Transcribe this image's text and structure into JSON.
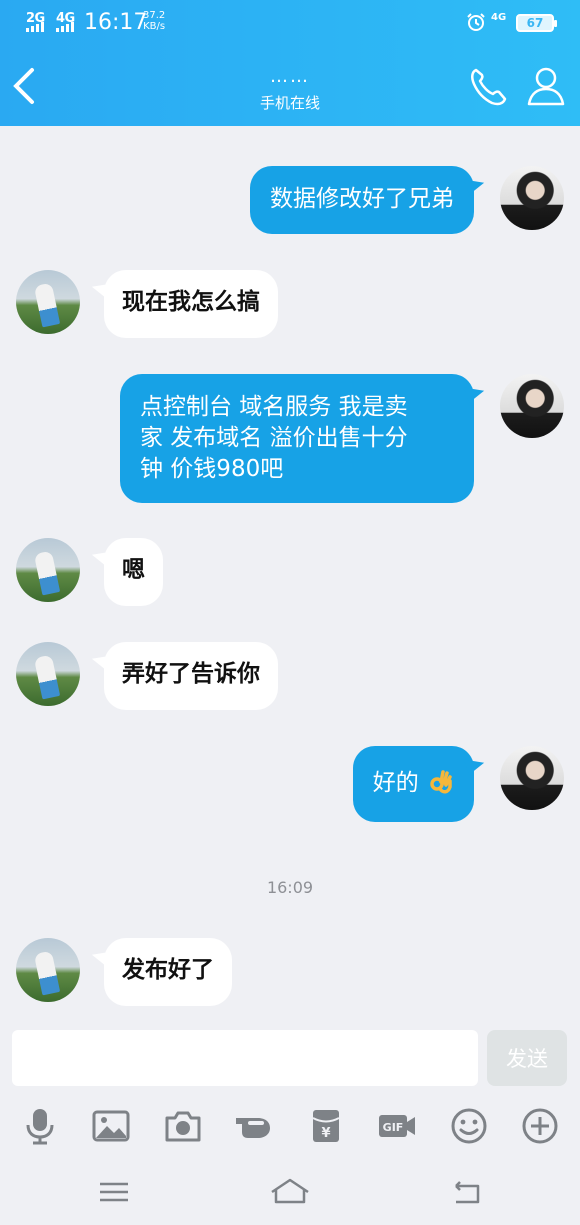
{
  "status_bar": {
    "sim1": "2G",
    "sim2": "4G",
    "time": "16:17",
    "speed_value": "37.2",
    "speed_unit": "KB/s",
    "network": "4G",
    "battery": "67"
  },
  "header": {
    "nickname": "……",
    "status": "手机在线",
    "back_icon": "chevron-left-icon",
    "call_icon": "phone-icon",
    "profile_icon": "person-icon",
    "color": "#2aa9f2"
  },
  "messages": [
    {
      "side": "me",
      "text": "数据修改好了兄弟"
    },
    {
      "side": "other",
      "text": "现在我怎么搞"
    },
    {
      "side": "me",
      "lines": [
        "点控制台  域名服务 我是卖",
        "家 发布域名  溢价出售十分",
        "钟  价钱980吧"
      ]
    },
    {
      "side": "other",
      "text": "嗯"
    },
    {
      "side": "other",
      "text": "弄好了告诉你"
    },
    {
      "side": "me",
      "text": "好的",
      "emoji": "ok-hand-icon"
    },
    {
      "side": "other",
      "text": "发布好了"
    }
  ],
  "timestamp": "16:09",
  "input": {
    "placeholder": "",
    "value": "",
    "send_label": "发送"
  },
  "toolbar": [
    "microphone-icon",
    "image-icon",
    "camera-icon",
    "poke-hand-icon",
    "red-packet-icon",
    "gif-icon",
    "smiley-icon",
    "plus-icon"
  ],
  "nav": [
    "menu-icon",
    "home-icon",
    "back-icon"
  ],
  "colors": {
    "bubble_me": "#17a2e6",
    "bubble_other": "#ffffff",
    "background": "#eff0f4"
  }
}
